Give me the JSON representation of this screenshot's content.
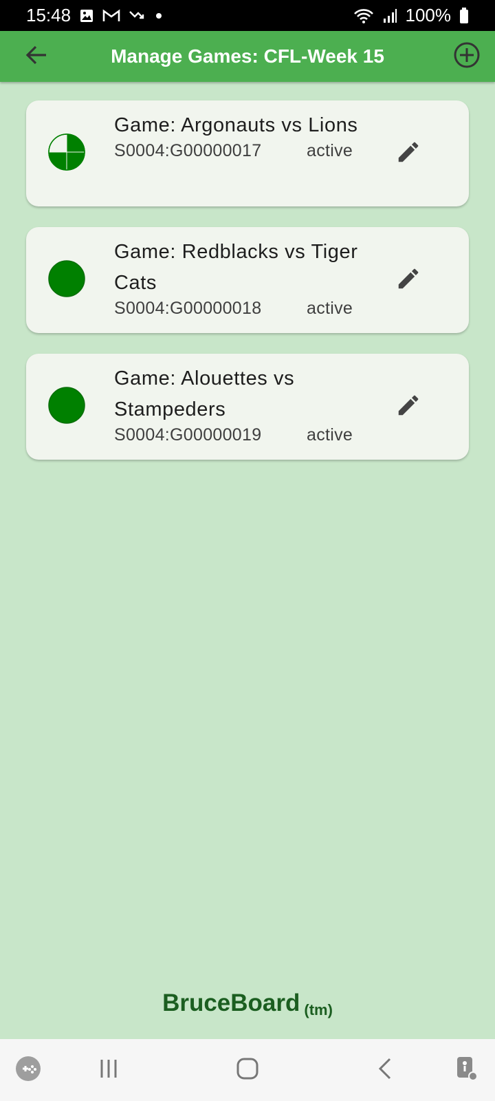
{
  "status_bar": {
    "time": "15:48",
    "battery": "100%",
    "icons": [
      "image-icon",
      "gmail-icon",
      "missed-call-icon",
      "dot-icon",
      "wifi-icon",
      "signal-icon",
      "battery-icon"
    ]
  },
  "app_bar": {
    "title": "Manage Games: CFL-Week 15",
    "back_icon": "arrow-back-icon",
    "add_icon": "add-circle-icon"
  },
  "games": [
    {
      "title": "Game: Argonauts vs Lions",
      "id": "S0004:G00000017",
      "status": "active",
      "progress_fraction": 0.75,
      "progress_icon": "quarter-pie-icon"
    },
    {
      "title": "Game: Redblacks vs Tiger Cats",
      "id": "S0004:G00000018",
      "status": "active",
      "progress_fraction": 1.0,
      "progress_icon": "full-circle-icon"
    },
    {
      "title": "Game: Alouettes vs Stampeders",
      "id": "S0004:G00000019",
      "status": "active",
      "progress_fraction": 1.0,
      "progress_icon": "full-circle-icon"
    }
  ],
  "footer": {
    "brand": "BruceBoard",
    "tm": "(tm)"
  },
  "nav_bar": {
    "icons": [
      "game-launcher-icon",
      "recents-icon",
      "home-icon",
      "back-icon",
      "accessibility-icon"
    ]
  },
  "colors": {
    "app_bar": "#4caf50",
    "background": "#c8e6c9",
    "card": "#f1f5ee",
    "status_green": "#008000",
    "brand": "#1b5e20"
  }
}
